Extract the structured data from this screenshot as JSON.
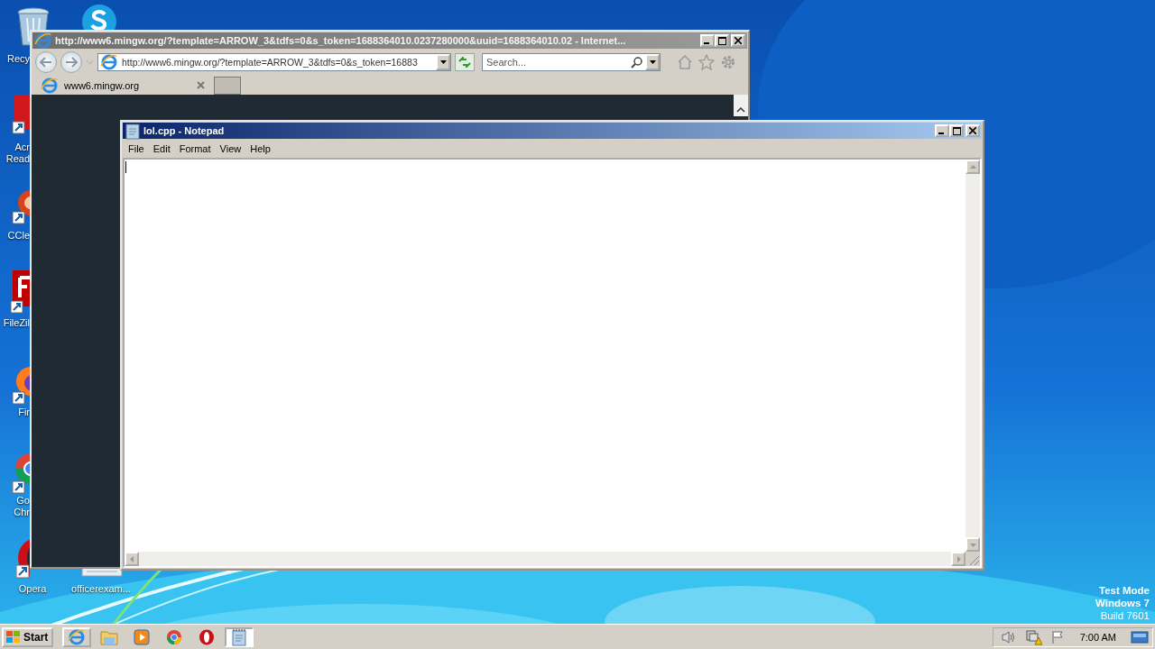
{
  "desktop": {
    "icons": [
      {
        "kind": "recycle",
        "lines": [
          "Recy"
        ]
      },
      {
        "kind": "skype"
      },
      {
        "kind": "acrobat",
        "lines": [
          "Acr",
          "Read"
        ]
      },
      {
        "kind": "ccleaner",
        "lines": [
          "CCle"
        ]
      },
      {
        "kind": "filezilla",
        "lines": [
          "FileZil"
        ]
      },
      {
        "kind": "firefox",
        "lines": [
          "Fir"
        ]
      },
      {
        "kind": "chrome",
        "lines": [
          "Go",
          "Chr"
        ]
      },
      {
        "kind": "opera",
        "lines": [
          "Opera"
        ]
      },
      {
        "kind": "file",
        "lines": [
          "officerexam..."
        ]
      }
    ],
    "system_info": [
      "Test Mode",
      "Windows 7",
      "Build 7601"
    ]
  },
  "browser": {
    "title": "http://www6.mingw.org/?template=ARROW_3&tdfs=0&s_token=1688364010.0237280000&uuid=1688364010.02 - Internet...",
    "active": false,
    "address": "http://www6.mingw.org/?template=ARROW_3&tdfs=0&s_token=16883",
    "search": {
      "placeholder": "Search..."
    },
    "tabs": [
      {
        "label": "www6.mingw.org",
        "selected": true
      }
    ]
  },
  "notepad": {
    "title": "lol.cpp - Notepad",
    "active": true,
    "menu": [
      "File",
      "Edit",
      "Format",
      "View",
      "Help"
    ]
  },
  "taskbar": {
    "start": "Start",
    "buttons": [
      {
        "kind": "ie",
        "running": true,
        "selected": false
      },
      {
        "kind": "explorer",
        "running": false,
        "selected": false
      },
      {
        "kind": "media",
        "running": false,
        "selected": false
      },
      {
        "kind": "chrome",
        "running": false,
        "selected": false
      },
      {
        "kind": "opera",
        "running": false,
        "selected": false
      },
      {
        "kind": "notepad",
        "running": true,
        "selected": true
      }
    ],
    "clock": "7:00 AM"
  }
}
